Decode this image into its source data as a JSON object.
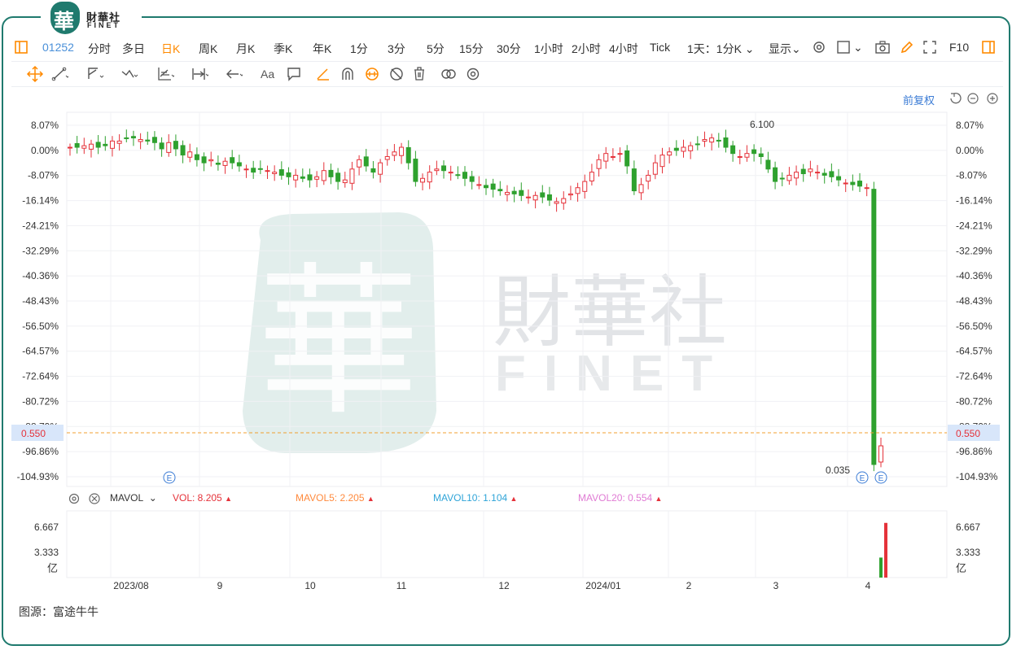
{
  "brand": {
    "seal_char": "華",
    "cn": "財華社",
    "en": "FINET"
  },
  "toolbar": {
    "code": "01252",
    "periods": [
      "分时",
      "多日",
      "日K",
      "周K",
      "月K",
      "季K",
      "年K",
      "1分",
      "3分",
      "5分",
      "15分",
      "30分",
      "1小时",
      "2小时",
      "4小时",
      "Tick"
    ],
    "active_period": "日K",
    "range_select": "1天：1分K",
    "display_label": "显示",
    "f10_label": "F10"
  },
  "drawing_tools": [
    "move-icon",
    "line-icon",
    "channel-icon",
    "wave-icon",
    "fibonacci-icon",
    "measure-icon",
    "arrow-icon",
    "text-icon",
    "comment-icon",
    "pen-icon",
    "magnet-icon",
    "lock-icon",
    "hide-icon",
    "delete-icon",
    "link-icon",
    "settings-icon"
  ],
  "fuquan_label": "前复权",
  "price_axis": {
    "labels": [
      "8.07%",
      "0.00%",
      "-8.07%",
      "-16.14%",
      "-24.21%",
      "-32.29%",
      "-40.36%",
      "-48.43%",
      "-56.50%",
      "-64.57%",
      "-72.64%",
      "-80.72%",
      "-88.79%",
      "-96.86%",
      "-104.93%"
    ],
    "right_labels": [
      "8.07%",
      "0.00%",
      "-8.07%",
      "-16.14%",
      "-24.21%",
      "-32.29%",
      "-40.36%",
      "-48.43%",
      "-56.50%",
      "-64.57%",
      "-72.64%",
      "-80.72%",
      "-88.79%",
      "-96.86%",
      "-104.93%"
    ],
    "current_price": "0.550",
    "high_label": "6.100",
    "low_label": "0.035"
  },
  "x_axis": {
    "labels": [
      "2023/08",
      "9",
      "10",
      "11",
      "12",
      "2024/01",
      "2",
      "3",
      "4"
    ]
  },
  "event_marker": "E",
  "volume": {
    "indicator": "MAVOL",
    "vol": "VOL: 8.205",
    "ma5": "MAVOL5: 2.205",
    "ma10": "MAVOL10: 1.104",
    "ma20": "MAVOL20: 0.554",
    "axis_labels": [
      "6.667",
      "3.333"
    ],
    "unit": "亿"
  },
  "colors": {
    "up": "#e5323a",
    "down": "#2ea12e",
    "accent": "#ff8a00",
    "brand": "#1f7a6e",
    "ma5": "#ff8a3d",
    "ma10": "#2fa4d8",
    "ma20": "#e07bd4"
  },
  "source": "图源：富途牛牛",
  "watermark": {
    "seal": "華",
    "cn": "財華社",
    "en": "FINET"
  },
  "chart_data": {
    "type": "candlestick",
    "y_unit": "percent change",
    "ylim": [
      -104.93,
      8.07
    ],
    "x_categories": [
      "2023/08",
      "9",
      "10",
      "11",
      "12",
      "2024/01",
      "2",
      "3",
      "4"
    ],
    "high_price": 6.1,
    "low_price": 0.035,
    "last_price": 0.55,
    "volume_unit": "亿",
    "last_volume": 8.205,
    "candles_pct_close": [
      1,
      1,
      1.5,
      2,
      1,
      1.5,
      3,
      3,
      4,
      4,
      3.5,
      3,
      2.5,
      0.5,
      2.5,
      0.5,
      -1.5,
      -0.5,
      -3,
      -4,
      -3,
      -4.5,
      -3.5,
      -4,
      -5,
      -6,
      -7,
      -6,
      -6.5,
      -7,
      -8,
      -8.5,
      -8,
      -9,
      -9.5,
      -8.5,
      -6.5,
      -8.5,
      -10,
      -9.5,
      -6,
      -3,
      -5,
      -7,
      -4,
      -2,
      -0.5,
      1,
      -4,
      -10,
      -9,
      -7,
      -6,
      -6.5,
      -7,
      -8,
      -9,
      -10,
      -11,
      -12,
      -12.5,
      -13,
      -13.5,
      -14,
      -14.5,
      -15,
      -14.5,
      -15,
      -16,
      -16.5,
      -15.5,
      -14,
      -12,
      -10,
      -7,
      -3,
      -1,
      -2,
      -1,
      -5,
      -13,
      -11,
      -8,
      -4,
      -1.5,
      -0.5,
      0,
      1,
      1.5,
      2,
      3.5,
      4,
      3,
      1,
      -1,
      -2,
      -1,
      -1,
      -2,
      -6,
      -10,
      -9,
      -8,
      -7,
      -7.5,
      -6,
      -7,
      -8,
      -8.5,
      -9.5,
      -10.5,
      -11,
      -11.5,
      -12,
      -101,
      -95
    ],
    "volume_last_bars": [
      3.0,
      8.2
    ]
  }
}
